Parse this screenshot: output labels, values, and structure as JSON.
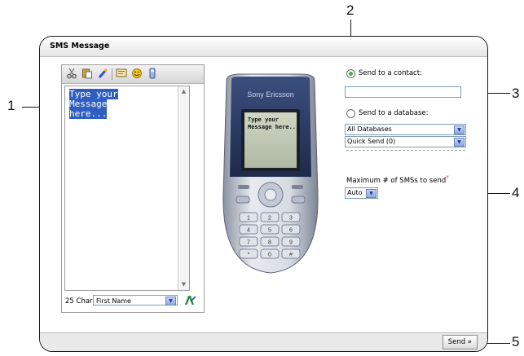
{
  "window": {
    "title": "SMS Message"
  },
  "callouts": [
    "1",
    "2",
    "3",
    "4",
    "5"
  ],
  "composer": {
    "toolbar_icons": [
      "cut-icon",
      "paste-icon",
      "eraser-icon",
      "template-icon",
      "smiley-icon",
      "phone-icon"
    ],
    "message_text_line1": "Type your Message",
    "message_text_line2": "here...",
    "char_count": "25 Chars",
    "field_select_value": "First Name"
  },
  "phone": {
    "brand": "Sony Ericsson",
    "screen_text_line1": "Type your",
    "screen_text_line2": "Message here...",
    "keys": [
      "1",
      "2",
      "3",
      "4",
      "5",
      "6",
      "7",
      "8",
      "9",
      "*",
      "0",
      "#"
    ]
  },
  "options": {
    "contact_label": "Send to a contact:",
    "contact_value": "",
    "database_label": "Send to a database:",
    "database_select": "All Databases",
    "quicksend_select": "Quick Send  (0)",
    "max_sms_label": "Maximum # of SMSs to send",
    "max_sms_required": "*",
    "max_sms_value": "Auto"
  },
  "footer": {
    "send_label": "Send »"
  },
  "colors": {
    "selection": "#2e5fc0",
    "radio_active": "#36b24a",
    "select_border": "#7f9db9"
  }
}
